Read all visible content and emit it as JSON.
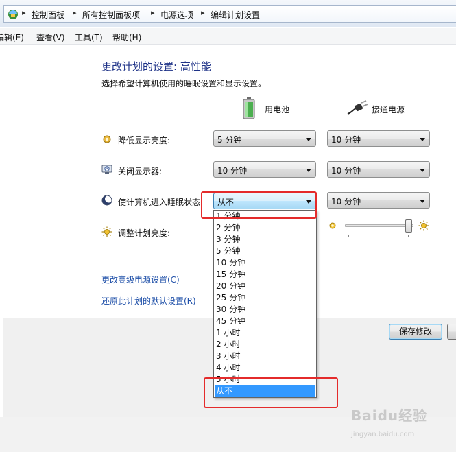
{
  "breadcrumb": {
    "items": [
      "控制面板",
      "所有控制面板项",
      "电源选项",
      "编辑计划设置"
    ]
  },
  "menu": {
    "items": [
      "编辑(E)",
      "查看(V)",
      "工具(T)",
      "帮助(H)"
    ]
  },
  "main": {
    "title": "更改计划的设置: 高性能",
    "subtitle": "选择希望计算机使用的睡眠设置和显示设置。",
    "columns": {
      "battery": "用电池",
      "plugged": "接通电源"
    },
    "rows": [
      {
        "label": "降低显示亮度:",
        "battery": "5 分钟",
        "plugged": "10 分钟",
        "icon": "dim-display-icon"
      },
      {
        "label": "关闭显示器:",
        "battery": "10 分钟",
        "plugged": "10 分钟",
        "icon": "monitor-off-icon"
      },
      {
        "label": "使计算机进入睡眠状态:",
        "battery": "从不",
        "plugged": "10 分钟",
        "icon": "sleep-moon-icon"
      }
    ],
    "brightness": {
      "label": "调整计划亮度:",
      "plugged_level_percent": 100
    },
    "links": {
      "advanced": "更改高级电源设置(C)",
      "restore": "还原此计划的默认设置(R)"
    }
  },
  "footer": {
    "save_label": "保存修改"
  },
  "dropdown": {
    "options": [
      "1 分钟",
      "2 分钟",
      "3 分钟",
      "5 分钟",
      "10 分钟",
      "15 分钟",
      "20 分钟",
      "25 分钟",
      "30 分钟",
      "45 分钟",
      "1 小时",
      "2 小时",
      "3 小时",
      "4 小时",
      "5 小时",
      "从不"
    ],
    "selected": "从不"
  },
  "watermark": {
    "text": "Baidu经验",
    "sub": "jingyan.baidu.com"
  },
  "colors": {
    "title": "#1e3287",
    "link": "#1e4fa8",
    "highlight": "#3399ff",
    "annotation": "#e42b2b"
  }
}
